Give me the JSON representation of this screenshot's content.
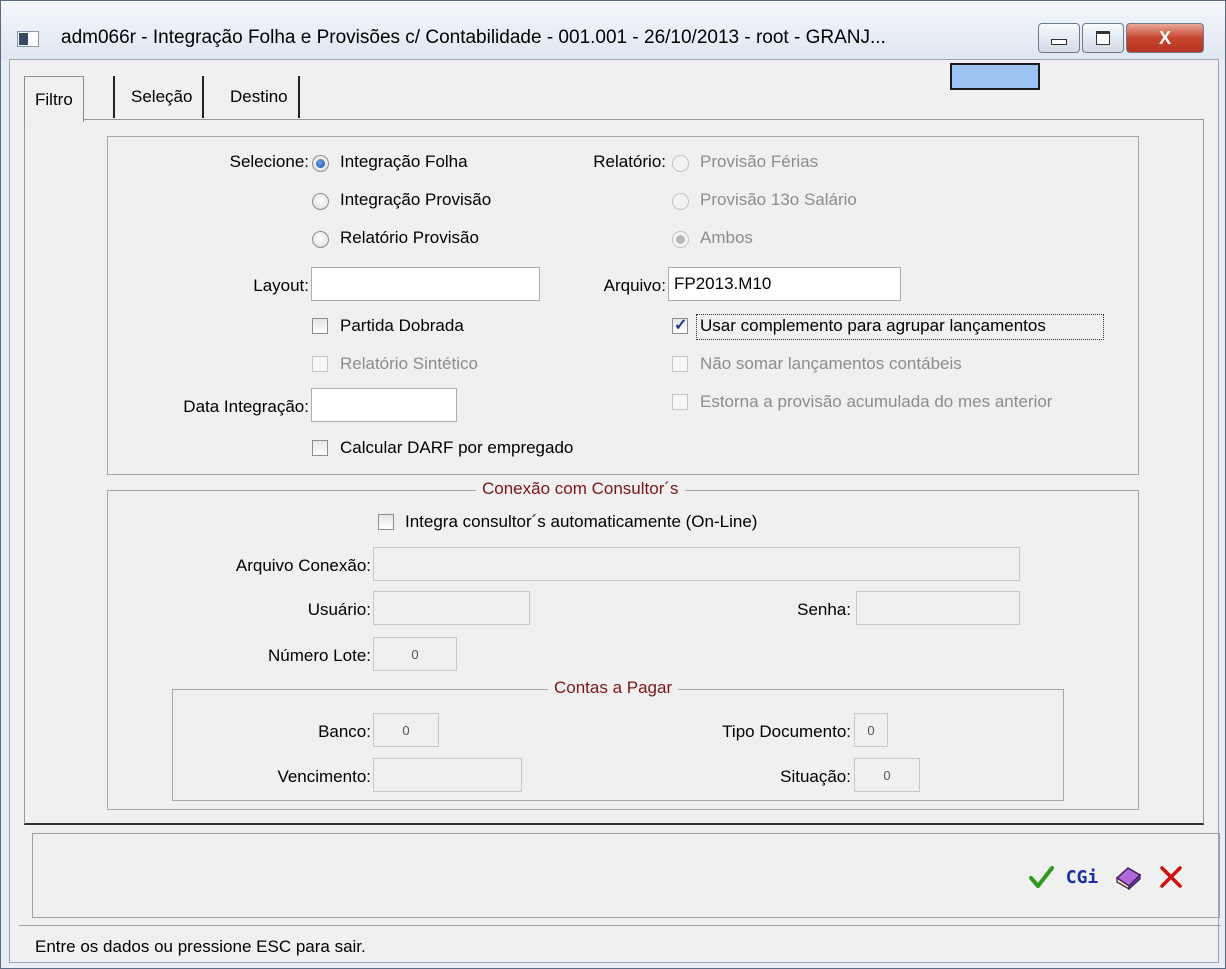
{
  "window": {
    "title": "adm066r - Integração Folha e Provisões c/ Contabilidade - 001.001 - 26/10/2013 - root - GRANJ...",
    "controls": {
      "minimize": "▭",
      "maximize": "▢",
      "close": "X"
    }
  },
  "tabs": [
    {
      "label": "Filtro",
      "active": true
    },
    {
      "label": "Seleção",
      "active": false
    },
    {
      "label": "Destino",
      "active": false
    }
  ],
  "form": {
    "selecione_label": "Selecione:",
    "selecione_options": [
      {
        "label": "Integração Folha",
        "selected": true,
        "enabled": true
      },
      {
        "label": "Integração Provisão",
        "selected": false,
        "enabled": true
      },
      {
        "label": "Relatório Provisão",
        "selected": false,
        "enabled": true
      }
    ],
    "relatorio_label": "Relatório:",
    "relatorio_options": [
      {
        "label": "Provisão Férias",
        "selected": false,
        "enabled": false
      },
      {
        "label": "Provisão 13o Salário",
        "selected": false,
        "enabled": false
      },
      {
        "label": "Ambos",
        "selected": true,
        "enabled": false
      }
    ],
    "layout_label": "Layout:",
    "layout_value": "",
    "arquivo_label": "Arquivo:",
    "arquivo_value": "FP2013.M10",
    "partida_dobrada": {
      "label": "Partida Dobrada",
      "checked": false,
      "enabled": true
    },
    "relatorio_sintetico": {
      "label": "Relatório Sintético",
      "checked": false,
      "enabled": false
    },
    "usar_complemento": {
      "label": "Usar complemento para agrupar lançamentos",
      "checked": true,
      "enabled": true
    },
    "nao_somar": {
      "label": "Não somar lançamentos contábeis",
      "checked": false,
      "enabled": false
    },
    "estorna_provisao": {
      "label": "Estorna a provisão acumulada do mes anterior",
      "checked": false,
      "enabled": false
    },
    "data_integracao_label": "Data Integração:",
    "data_integracao_value": "",
    "calcular_darf": {
      "label": "Calcular DARF por empregado",
      "checked": false,
      "enabled": true
    }
  },
  "consultor": {
    "title": "Conexão com Consultor´s",
    "integra": {
      "label": "Integra consultor´s automaticamente (On-Line)",
      "checked": false
    },
    "arquivo_conexao_label": "Arquivo Conexão:",
    "arquivo_conexao_value": "",
    "usuario_label": "Usuário:",
    "usuario_value": "",
    "senha_label": "Senha:",
    "senha_value": "",
    "numero_lote_label": "Número Lote:",
    "numero_lote_value": "0"
  },
  "contas_pagar": {
    "title": "Contas a Pagar",
    "banco_label": "Banco:",
    "banco_value": "0",
    "tipo_documento_label": "Tipo Documento:",
    "tipo_documento_value": "0",
    "vencimento_label": "Vencimento:",
    "vencimento_value": "",
    "situacao_label": "Situação:",
    "situacao_value": "0"
  },
  "toolbar": {
    "ok_icon": "checkmark-icon",
    "cgi_label": "CGi",
    "help_icon": "book-icon",
    "cancel_icon": "cancel-x-icon",
    "colors": {
      "ok": "#2e9a1a",
      "cgi": "#1a2fa8",
      "cancel": "#d01010"
    }
  },
  "status": {
    "message": "Entre os dados ou pressione ESC para sair."
  }
}
